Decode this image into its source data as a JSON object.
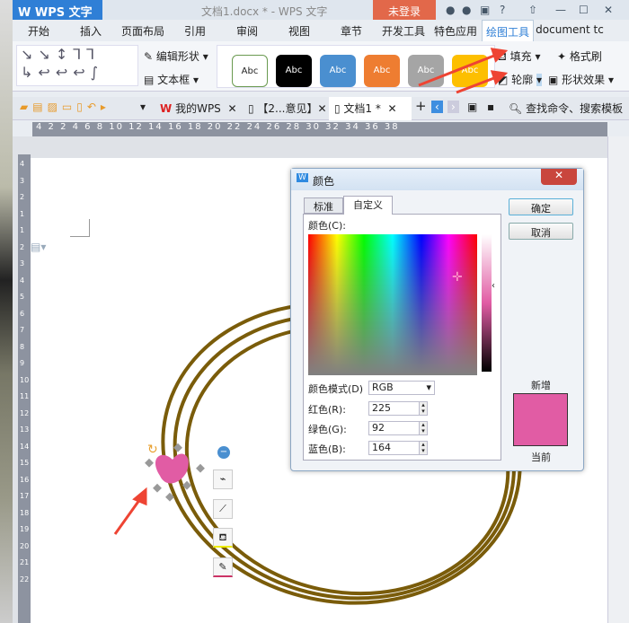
{
  "app": {
    "logo": "W WPS 文字",
    "title": "文档1.docx * - WPS 文字",
    "login": "未登录"
  },
  "menu_tabs": [
    "开始",
    "插入",
    "页面布局",
    "引用",
    "审阅",
    "视图",
    "章节",
    "开发工具",
    "特色应用",
    "绘图工具",
    "document tc"
  ],
  "ribbon": {
    "edit_shape": "编辑形状",
    "text_box": "文本框",
    "style_label": "Abc",
    "fill": "填充",
    "format_painter": "格式刷",
    "outline": "轮廓",
    "shape_effect": "形状效果"
  },
  "style_colors": [
    "#ffffff",
    "#000000",
    "#4a8fd0",
    "#ee7d31",
    "#a5a5a5",
    "#fdbf00"
  ],
  "doc_tabs": {
    "my_wps": "我的WPS",
    "tab2": "【2...意见】",
    "tab3": "文档1 *",
    "search": "查找命令、搜索模板"
  },
  "ruler": "4 2 2 4 6 8 10 12 14 16 18 20 22 24 26 28 30 32 34 36 38",
  "vruler": [
    "4",
    "3",
    "2",
    "1",
    "1",
    "2",
    "3",
    "4",
    "5",
    "6",
    "7",
    "8",
    "9",
    "10",
    "11",
    "12",
    "13",
    "14",
    "15",
    "16",
    "17",
    "18",
    "19",
    "20",
    "21",
    "22"
  ],
  "dialog": {
    "title": "颜色",
    "tab_standard": "标准",
    "tab_custom": "自定义",
    "color_label": "颜色(C):",
    "mode_label": "颜色模式(D)",
    "mode_value": "RGB",
    "red_label": "红色(R):",
    "red": "225",
    "green_label": "绿色(G):",
    "green": "92",
    "blue_label": "蓝色(B):",
    "blue": "164",
    "ok": "确定",
    "cancel": "取消",
    "new_label": "新增",
    "current_label": "当前",
    "preview_color": "#e15ca4"
  },
  "accent": "#2f7fd6",
  "ring_color": "#7a5c0a"
}
